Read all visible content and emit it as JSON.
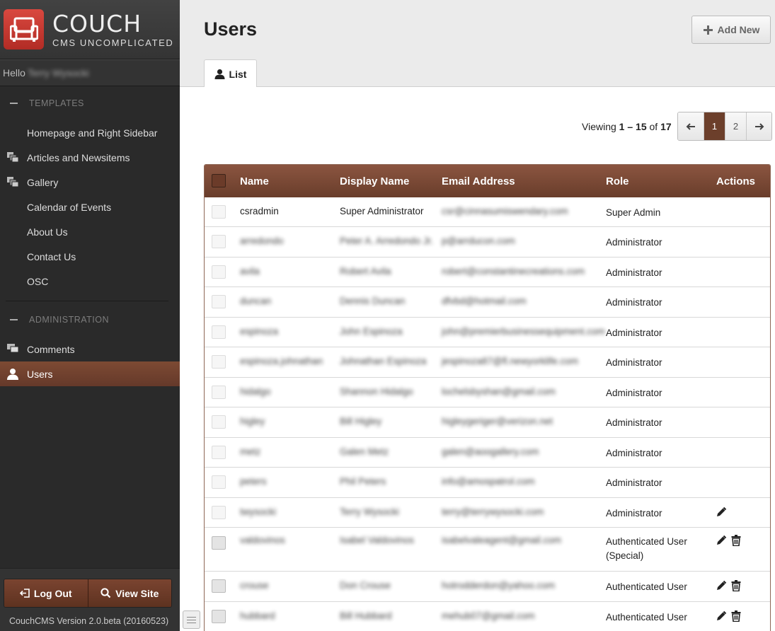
{
  "brand": {
    "title": "COUCH",
    "subtitle": "CMS UNCOMPLICATED"
  },
  "hello": {
    "label": "Hello",
    "user": "Terry Wysocki"
  },
  "sidebar": {
    "templates_heading": "TEMPLATES",
    "templates": [
      {
        "label": "Homepage and Right Sidebar",
        "icon": ""
      },
      {
        "label": "Articles and Newsitems",
        "icon": "stack-icon"
      },
      {
        "label": "Gallery",
        "icon": "stack-icon"
      },
      {
        "label": "Calendar of Events",
        "icon": ""
      },
      {
        "label": "About Us",
        "icon": ""
      },
      {
        "label": "Contact Us",
        "icon": ""
      },
      {
        "label": "OSC",
        "icon": ""
      }
    ],
    "admin_heading": "ADMINISTRATION",
    "admin": [
      {
        "label": "Comments",
        "icon": "comments-icon",
        "active": false
      },
      {
        "label": "Users",
        "icon": "user-icon",
        "active": true
      }
    ],
    "logout": "Log Out",
    "viewsite": "View Site",
    "version": "CouchCMS Version 2.0.beta (20160523)"
  },
  "header": {
    "title": "Users",
    "add_new": "Add New",
    "tab": "List"
  },
  "pagination": {
    "viewing_prefix": "Viewing",
    "from": "1",
    "sep": "–",
    "to": "15",
    "of": "of",
    "total": "17",
    "pages": [
      "1",
      "2"
    ],
    "current": "1"
  },
  "table": {
    "columns": [
      "Name",
      "Display Name",
      "Email Address",
      "Role",
      "Actions"
    ],
    "rows": [
      {
        "name": "csradmin",
        "display": "Super Administrator",
        "email": "csr@cinnasumiswendary.com",
        "role": "Super Admin",
        "role2": "",
        "edit": false,
        "del": false,
        "blur_name": false,
        "blur_display": false
      },
      {
        "name": "arredondo",
        "display": "Peter A. Arredondo Jr.",
        "email": "p@arrducon.com",
        "role": "Administrator",
        "role2": "",
        "edit": false,
        "del": false,
        "blur_name": true,
        "blur_display": true
      },
      {
        "name": "avila",
        "display": "Robert Avila",
        "email": "robert@constantinecreations.com",
        "role": "Administrator",
        "role2": "",
        "edit": false,
        "del": false,
        "blur_name": true,
        "blur_display": true
      },
      {
        "name": "duncan",
        "display": "Dennis Duncan",
        "email": "dfvbd@hotmail.com",
        "role": "Administrator",
        "role2": "",
        "edit": false,
        "del": false,
        "blur_name": true,
        "blur_display": true
      },
      {
        "name": "espinoza",
        "display": "John Espinoza",
        "email": "john@premierbusinessequipment.com",
        "role": "Administrator",
        "role2": "",
        "edit": false,
        "del": false,
        "blur_name": true,
        "blur_display": true
      },
      {
        "name": "espinoza.johnathan",
        "display": "Johnathan Espinoza",
        "email": "jespinoza87@fl.newyorklife.com",
        "role": "Administrator",
        "role2": "",
        "edit": false,
        "del": false,
        "blur_name": true,
        "blur_display": true
      },
      {
        "name": "hidalgo",
        "display": "Shannon Hidalgo",
        "email": "lochelsbyshan@gmail.com",
        "role": "Administrator",
        "role2": "",
        "edit": false,
        "del": false,
        "blur_name": true,
        "blur_display": true
      },
      {
        "name": "higley",
        "display": "Bill Higley",
        "email": "higleygeriger@verizon.net",
        "role": "Administrator",
        "role2": "",
        "edit": false,
        "del": false,
        "blur_name": true,
        "blur_display": true
      },
      {
        "name": "metz",
        "display": "Galen Metz",
        "email": "galen@aoogallery.com",
        "role": "Administrator",
        "role2": "",
        "edit": false,
        "del": false,
        "blur_name": true,
        "blur_display": true
      },
      {
        "name": "peters",
        "display": "Phil Peters",
        "email": "info@amospatrol.com",
        "role": "Administrator",
        "role2": "",
        "edit": false,
        "del": false,
        "blur_name": true,
        "blur_display": true
      },
      {
        "name": "twysocki",
        "display": "Terry Wysocki",
        "email": "terry@terrywysocki.com",
        "role": "Administrator",
        "role2": "",
        "edit": true,
        "del": false,
        "blur_name": true,
        "blur_display": true
      },
      {
        "name": "valdovinos",
        "display": "Isabel Valdovinos",
        "email": "isabelvaleagent@gmail.com",
        "role": "Authenticated User",
        "role2": "(Special)",
        "edit": true,
        "del": true,
        "blur_name": true,
        "blur_display": true
      },
      {
        "name": "crouse",
        "display": "Don Crouse",
        "email": "hotrodderdon@yahoo.com",
        "role": "Authenticated User",
        "role2": "",
        "edit": true,
        "del": true,
        "blur_name": true,
        "blur_display": true
      },
      {
        "name": "hubbard",
        "display": "Bill Hubbard",
        "email": "mehub07@gmail.com",
        "role": "Authenticated User",
        "role2": "",
        "edit": true,
        "del": true,
        "blur_name": true,
        "blur_display": true
      }
    ]
  }
}
